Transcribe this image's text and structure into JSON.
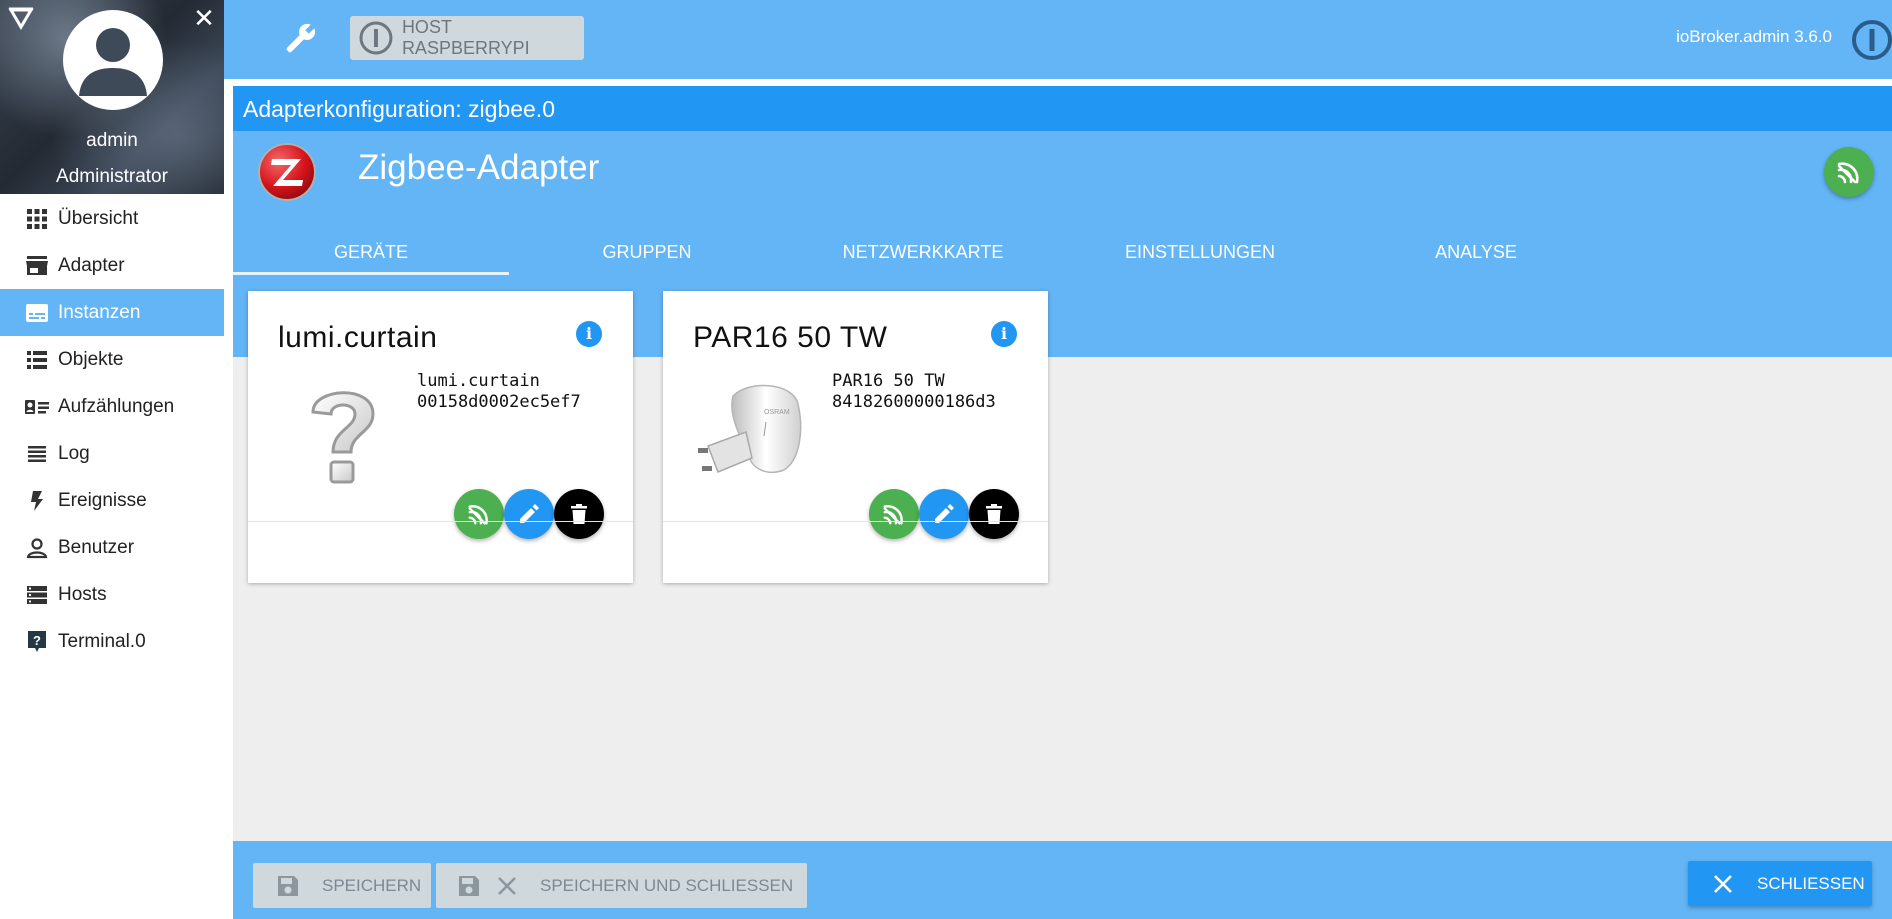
{
  "sidebar": {
    "user": {
      "name": "admin",
      "role": "Administrator"
    },
    "items": [
      {
        "label": "Übersicht",
        "icon": "apps-icon"
      },
      {
        "label": "Adapter",
        "icon": "store-icon"
      },
      {
        "label": "Instanzen",
        "icon": "subtitles-icon",
        "active": true
      },
      {
        "label": "Objekte",
        "icon": "list-icon"
      },
      {
        "label": "Aufzählungen",
        "icon": "contact-card-icon"
      },
      {
        "label": "Log",
        "icon": "lines-icon"
      },
      {
        "label": "Ereignisse",
        "icon": "flash-icon"
      },
      {
        "label": "Benutzer",
        "icon": "person-icon"
      },
      {
        "label": "Hosts",
        "icon": "storage-icon"
      },
      {
        "label": "Terminal.0",
        "icon": "help-box-icon"
      }
    ]
  },
  "topbar": {
    "host_label": "HOST RASPBERRYPI",
    "version": "ioBroker.admin 3.6.0"
  },
  "main": {
    "config_title": "Adapterkonfiguration: zigbee.0",
    "adapter_name": "Zigbee-Adapter",
    "tabs": [
      "GERÄTE",
      "GRUPPEN",
      "NETZWERKKARTE",
      "EINSTELLUNGEN",
      "ANALYSE"
    ],
    "active_tab": "GERÄTE",
    "devices": [
      {
        "title": "lumi.curtain",
        "model": "lumi.curtain",
        "id": "00158d0002ec5ef7",
        "image": "question-mark-icon"
      },
      {
        "title": "PAR16 50 TW",
        "model": "PAR16 50 TW",
        "id": "84182600000186d3",
        "image": "led-bulb-icon"
      }
    ]
  },
  "footer": {
    "save": "SPEICHERN",
    "save_close": "SPEICHERN UND SCHLIESSEN",
    "close": "SCHLIESSEN"
  },
  "colors": {
    "accent": "#2196f3",
    "bar": "#63b5f6",
    "status_green": "#4caf50"
  }
}
